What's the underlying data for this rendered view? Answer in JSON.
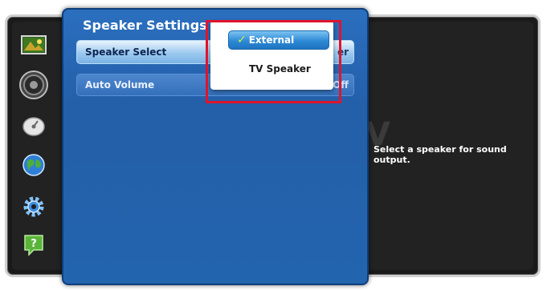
{
  "panel": {
    "title": "Speaker Settings",
    "rows": [
      {
        "label": "Speaker Select",
        "value": "er"
      },
      {
        "label": "Auto Volume",
        "value": "Off"
      }
    ]
  },
  "popup": {
    "options": [
      {
        "label": "External",
        "checked": true,
        "check_mark": "✓"
      },
      {
        "label": "TV Speaker",
        "checked": false
      }
    ]
  },
  "help": {
    "text": "Select a speaker for sound output.",
    "background_letter": "V"
  },
  "rail": {
    "icons": [
      "picture-icon",
      "sound-icon",
      "broadcast-icon",
      "network-icon",
      "system-gear-icon",
      "support-help-icon"
    ]
  },
  "colors": {
    "panel_blue": "#2b6fbf",
    "selected_row": "#9cc9ef",
    "popup_selected": "#2d8ad6",
    "highlight": "#e0142c",
    "frame": "#1a1a1a"
  }
}
